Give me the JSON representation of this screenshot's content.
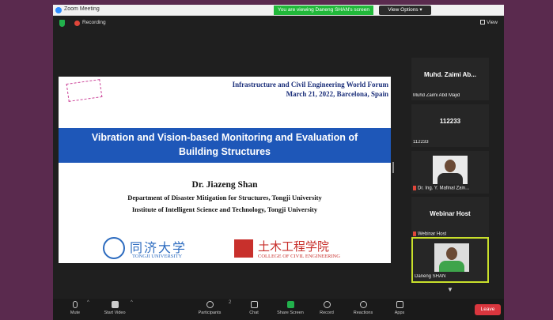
{
  "window": {
    "title": "Zoom Meeting",
    "share_banner": "You are viewing Daneng SHAN's screen",
    "view_options": "View Options ▾",
    "recording": "Recording",
    "view_label": "View"
  },
  "slide": {
    "conference_name": "Infrastructure and Civil Engineering World Forum",
    "conference_date": "March 21, 2022, Barcelona, Spain",
    "title_line1": "Vibration and Vision-based Monitoring and Evaluation of",
    "title_line2": "Building Structures",
    "speaker": "Dr. Jiazeng Shan",
    "affiliation1": "Department of Disaster Mitigation for Structures, Tongji University",
    "affiliation2": "Institute of Intelligent Science and Technology, Tongji University",
    "logo_left_cn": "同济大学",
    "logo_left_en": "TONGJI UNIVERSITY",
    "logo_right_cn": "土木工程学院",
    "logo_right_en": "COLLEGE OF CIVIL ENGINEERING"
  },
  "participants": [
    {
      "display": "Muhd. Zaimi Ab...",
      "label": "Muhd Zaimi Abd Majid",
      "muted": false
    },
    {
      "display": "112233",
      "label": "112233",
      "muted": false
    },
    {
      "display": "",
      "label": "Dr. Ing. Y. Mafinal Zain...",
      "muted": true
    },
    {
      "display": "Webinar Host",
      "label": "Webinar Host",
      "muted": true
    },
    {
      "display": "",
      "label": "Daneng SHAN",
      "muted": false
    }
  ],
  "toolbar": {
    "mute": "Mute",
    "start_video": "Start Video",
    "participants": "Participants",
    "participants_count": "2",
    "chat": "Chat",
    "share_screen": "Share Screen",
    "record": "Record",
    "reactions": "Reactions",
    "apps": "Apps",
    "leave": "Leave"
  },
  "colors": {
    "window_bg": "#1f1f1f",
    "page_bg": "#5a2a4e",
    "share_banner": "#21b83a",
    "slide_title_band": "#1e57b8",
    "leave": "#d9363e",
    "active_speaker_border": "#c9e02b"
  },
  "icons": [
    "shield-icon",
    "record-dot-icon",
    "grid-icon",
    "mute-icon",
    "microphone-icon",
    "camera-icon",
    "participants-icon",
    "chat-icon",
    "share-icon",
    "record-icon",
    "reactions-icon",
    "apps-icon",
    "chevron-down-icon"
  ]
}
